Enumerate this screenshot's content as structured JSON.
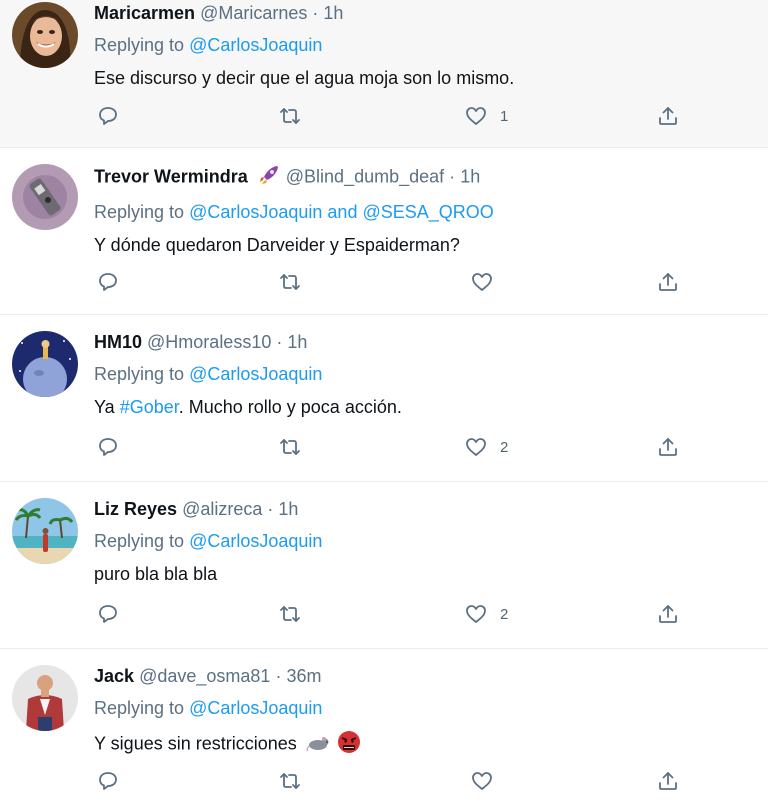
{
  "tweets": [
    {
      "name": "Maricarmen",
      "handle": "@Maricarnes",
      "dot": "·",
      "time": "1h",
      "replying_prefix": "Replying to",
      "mentions": "@CarlosJoaquin",
      "text": "Ese discurso y decir que el agua moja son lo mismo.",
      "likes": "1",
      "avatar_icon": "woman-smiling-avatar"
    },
    {
      "name": "Trevor Wermindra",
      "handle": "@Blind_dumb_deaf",
      "dot": "·",
      "time": "1h",
      "replying_prefix": "Replying to",
      "mentions": "@CarlosJoaquin and @SESA_QROO",
      "text": "Y dónde quedaron Darveider y Espaiderman?",
      "likes": "",
      "avatar_icon": "robot-avatar",
      "name_emoji": "rocket"
    },
    {
      "name": "HM10",
      "handle": "@Hmoraless10",
      "dot": "·",
      "time": "1h",
      "replying_prefix": "Replying to",
      "mentions": "@CarlosJoaquin",
      "text_prefix": "Ya ",
      "hashtag": "#Gober",
      "text_suffix": ". Mucho rollo y poca acción.",
      "likes": "2",
      "avatar_icon": "little-prince-planet-avatar"
    },
    {
      "name": "Liz Reyes",
      "handle": "@alizreca",
      "dot": "·",
      "time": "1h",
      "replying_prefix": "Replying to",
      "mentions": "@CarlosJoaquin",
      "text": "puro bla bla bla",
      "likes": "2",
      "avatar_icon": "beach-palm-avatar"
    },
    {
      "name": "Jack",
      "handle": "@dave_osma81",
      "dot": "·",
      "time": "36m",
      "replying_prefix": "Replying to",
      "mentions": "@CarlosJoaquin",
      "text": "Y sigues sin restricciones",
      "likes": "",
      "avatar_icon": "man-red-jacket-avatar",
      "text_emojis": [
        "rat",
        "angry-face"
      ]
    }
  ],
  "colors": {
    "link": "#1d9bf0",
    "secondary_text": "#5b7083",
    "hover_bg": "#f7f7f7",
    "divider": "#e6ecf0"
  },
  "action_icons": [
    "reply-icon",
    "retweet-icon",
    "like-icon",
    "share-icon"
  ]
}
